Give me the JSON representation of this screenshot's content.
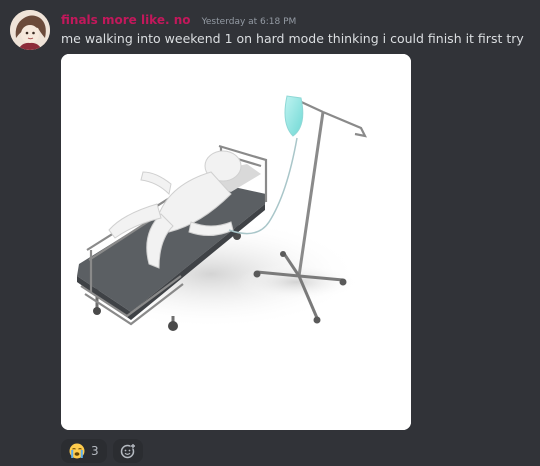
{
  "message": {
    "author": "finals more like. no",
    "timestamp": "Yesterday at 6:18 PM",
    "content": "me walking into weekend 1 on hard mode thinking i could finish it first try",
    "author_color": "#c2185b"
  },
  "attachment": {
    "type": "image",
    "icon": "hospital-bed-iv-drip-image"
  },
  "reactions": [
    {
      "emoji": "loudly-crying-face",
      "count": "3"
    }
  ],
  "add_reaction": {
    "icon": "add-reaction-icon"
  }
}
